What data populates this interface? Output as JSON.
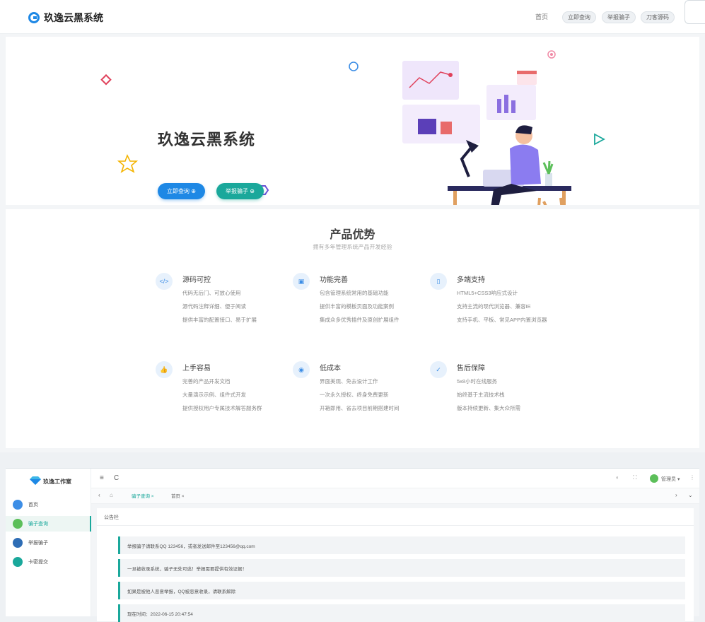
{
  "site": {
    "logo_text": "玖逸云黑系统",
    "nav": {
      "home": "首页",
      "buttons": [
        "立即查询",
        "举报骗子",
        "刀客源码"
      ]
    },
    "hero": {
      "title": "玖逸云黑系统",
      "btn_query": "立即查询 ⊕",
      "btn_report": "举报骗子 ⊕"
    },
    "features": {
      "title": "产品优势",
      "subtitle": "拥有多年管理系统产品开发经验",
      "items": [
        {
          "icon": "</>",
          "title": "源码可控",
          "lines": [
            "代码无后门、可放心使用",
            "源代码注释详细、便于阅读",
            "提供丰富的配置接口、易于扩展"
          ]
        },
        {
          "icon": "▣",
          "title": "功能完善",
          "lines": [
            "包含管理系统常用的基础功能",
            "提供丰富的模板页面及功能案例",
            "集成众多优秀插件及原创扩展组件"
          ]
        },
        {
          "icon": "▯",
          "title": "多端支持",
          "lines": [
            "HTML5+CSS3响应式设计",
            "支持主流的现代浏览器、兼容IE",
            "支持手机、平板、常见APP内置浏览器"
          ]
        },
        {
          "icon": "👍",
          "title": "上手容易",
          "lines": [
            "完善的产品开发文档",
            "大量演示示例、组件式开发",
            "提供授权用户专属技术解答服务群"
          ]
        },
        {
          "icon": "◉",
          "title": "低成本",
          "lines": [
            "界面美观、免去设计工作",
            "一次永久授权、终身免费更新",
            "开箱即用、省去项目前期搭建时间"
          ]
        },
        {
          "icon": "✓",
          "title": "售后保障",
          "lines": [
            "5x8小时在线服务",
            "始终基于主流技术栈",
            "版本持续更新、集大众所需"
          ]
        }
      ]
    }
  },
  "admin": {
    "brand": "玖逸工作室",
    "sidebar": [
      {
        "label": "首页",
        "color": "#3d8ee6"
      },
      {
        "label": "骗子查询",
        "color": "#5cbf5a"
      },
      {
        "label": "举报骗子",
        "color": "#2e6db5"
      },
      {
        "label": "卡密提交",
        "color": "#1aa89b"
      }
    ],
    "toolbar": {
      "menu": "≡",
      "refresh": "C",
      "user": "管理员 ▾"
    },
    "tabs": [
      "骗子查询 ×",
      "首页 ×"
    ],
    "notice_head": "公告栏",
    "notices": [
      "举报骗子请联系QQ 123456，或者发送邮件至123456@qq.com",
      "一旦被收录系统，骗子无处可逃！举报需要提供有效证据！",
      "如果是被他人恶意举报，QQ被恶意收录，请联系解除",
      "现在时间：2022-06-15 20:47:54"
    ]
  }
}
